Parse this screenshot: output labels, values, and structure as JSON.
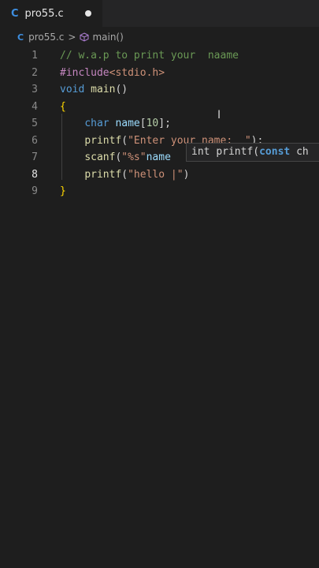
{
  "tab": {
    "icon_letter": "C",
    "filename": "pro55.c",
    "modified_dot": "●"
  },
  "breadcrumb": {
    "icon_letter": "C",
    "file": "pro55.c",
    "separator": ">",
    "symbol": "main()"
  },
  "lines": [
    {
      "number": "1",
      "parts": [
        [
          "comment",
          "// w.a.p to print your  naame"
        ]
      ]
    },
    {
      "number": "2",
      "parts": [
        [
          "pp",
          "#include"
        ],
        [
          "str",
          "<stdio.h>"
        ]
      ]
    },
    {
      "number": "3",
      "parts": [
        [
          "kw",
          "void"
        ],
        [
          "plain",
          " "
        ],
        [
          "fn",
          "main"
        ],
        [
          "plain",
          "()"
        ]
      ]
    },
    {
      "number": "4",
      "parts": [
        [
          "brace",
          "{"
        ]
      ]
    },
    {
      "number": "5",
      "parts": [
        [
          "plain",
          "    "
        ],
        [
          "kw",
          "char"
        ],
        [
          "plain",
          " "
        ],
        [
          "var",
          "name"
        ],
        [
          "plain",
          "["
        ],
        [
          "num",
          "10"
        ],
        [
          "plain",
          "];"
        ]
      ]
    },
    {
      "number": "6",
      "parts": [
        [
          "plain",
          "    "
        ],
        [
          "fn",
          "printf"
        ],
        [
          "plain",
          "("
        ],
        [
          "str",
          "\"Enter your name:  \""
        ],
        [
          "plain",
          ");"
        ]
      ]
    },
    {
      "number": "7",
      "parts": [
        [
          "plain",
          "    "
        ],
        [
          "fn",
          "scanf"
        ],
        [
          "plain",
          "("
        ],
        [
          "str",
          "\"%s\""
        ],
        [
          "var",
          "name"
        ]
      ]
    },
    {
      "number": "8",
      "parts": [
        [
          "plain",
          "    "
        ],
        [
          "fn",
          "printf"
        ],
        [
          "plain",
          "("
        ],
        [
          "str",
          "\"hello |\""
        ],
        [
          "plain",
          ")"
        ]
      ]
    },
    {
      "number": "9",
      "parts": [
        [
          "brace",
          "}"
        ]
      ]
    }
  ],
  "active_line": "8",
  "tooltip": {
    "ret": "int ",
    "fn": "printf(",
    "kw": "const",
    "rest": " ch"
  },
  "colors": {
    "background": "#1e1e1e",
    "tabbar": "#252526",
    "c_icon": "#3d8ee0"
  }
}
